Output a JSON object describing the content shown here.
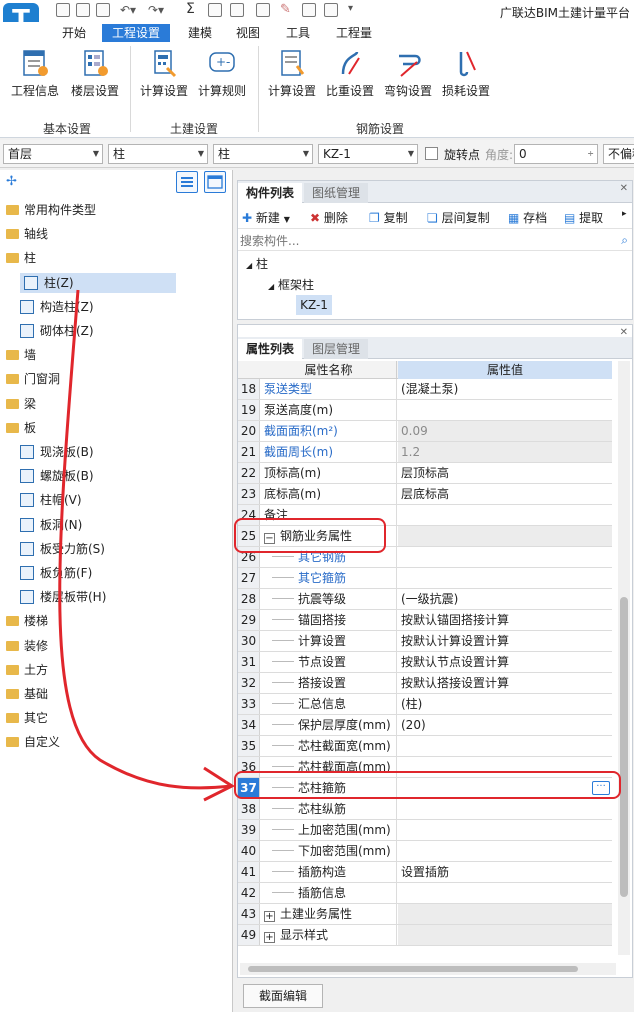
{
  "app": {
    "logo": "T",
    "title": "广联达BIM土建计量平台"
  },
  "ribbon": {
    "tabs": [
      "开始",
      "工程设置",
      "建模",
      "视图",
      "工具",
      "工程量"
    ],
    "active_tab": "工程设置",
    "buttons": [
      "工程信息",
      "楼层设置",
      "计算设置",
      "计算规则",
      "计算设置",
      "比重设置",
      "弯钩设置",
      "损耗设置"
    ],
    "groups": [
      "基本设置",
      "土建设置",
      "钢筋设置"
    ]
  },
  "toolbar": {
    "floor": "首层",
    "type1": "柱",
    "type2": "柱",
    "component": "KZ-1",
    "rotate_label": "旋转点",
    "angle_label": "角度:",
    "angle_value": "0",
    "extra": "不偏移"
  },
  "tree": {
    "items": [
      {
        "label": "常用构件类型",
        "folder": true
      },
      {
        "label": "轴线",
        "folder": true
      },
      {
        "label": "柱",
        "folder": true,
        "expanded": true
      },
      {
        "label": "柱(Z)",
        "child": true,
        "selected": true
      },
      {
        "label": "构造柱(Z)",
        "child": true
      },
      {
        "label": "砌体柱(Z)",
        "child": true
      },
      {
        "label": "墙",
        "folder": true
      },
      {
        "label": "门窗洞",
        "folder": true
      },
      {
        "label": "梁",
        "folder": true
      },
      {
        "label": "板",
        "folder": true,
        "expanded": true
      },
      {
        "label": "现浇板(B)",
        "child": true
      },
      {
        "label": "螺旋板(B)",
        "child": true
      },
      {
        "label": "柱帽(V)",
        "child": true
      },
      {
        "label": "板洞(N)",
        "child": true
      },
      {
        "label": "板受力筋(S)",
        "child": true
      },
      {
        "label": "板负筋(F)",
        "child": true
      },
      {
        "label": "楼层板带(H)",
        "child": true
      },
      {
        "label": "楼梯",
        "folder": true
      },
      {
        "label": "装修",
        "folder": true
      },
      {
        "label": "土方",
        "folder": true
      },
      {
        "label": "基础",
        "folder": true
      },
      {
        "label": "其它",
        "folder": true
      },
      {
        "label": "自定义",
        "folder": true
      }
    ]
  },
  "component_pane": {
    "tabs": [
      "构件列表",
      "图纸管理"
    ],
    "actions": [
      "新建",
      "删除",
      "复制",
      "层间复制",
      "存档",
      "提取"
    ],
    "search_placeholder": "搜索构件...",
    "tree": [
      "柱",
      "框架柱",
      "KZ-1"
    ]
  },
  "property_pane": {
    "tabs": [
      "属性列表",
      "图层管理"
    ],
    "col_name": "属性名称",
    "col_value": "属性值",
    "rows": [
      {
        "n": "18",
        "name": "泵送类型",
        "value": "(混凝土泵)",
        "blue": true
      },
      {
        "n": "19",
        "name": "泵送高度(m)",
        "value": ""
      },
      {
        "n": "20",
        "name": "截面面积(m²)",
        "value": "0.09",
        "blue": true,
        "grey": true
      },
      {
        "n": "21",
        "name": "截面周长(m)",
        "value": "1.2",
        "blue": true,
        "grey": true
      },
      {
        "n": "22",
        "name": "顶标高(m)",
        "value": "层顶标高"
      },
      {
        "n": "23",
        "name": "底标高(m)",
        "value": "层底标高"
      },
      {
        "n": "24",
        "name": "备注",
        "value": ""
      },
      {
        "n": "25",
        "name": "钢筋业务属性",
        "value": "",
        "group": "−"
      },
      {
        "n": "26",
        "name": "其它钢筋",
        "value": "",
        "blue": true,
        "indent": true
      },
      {
        "n": "27",
        "name": "其它箍筋",
        "value": "",
        "blue": true,
        "indent": true
      },
      {
        "n": "28",
        "name": "抗震等级",
        "value": "(一级抗震)",
        "indent": true
      },
      {
        "n": "29",
        "name": "锚固搭接",
        "value": "按默认锚固搭接计算",
        "indent": true
      },
      {
        "n": "30",
        "name": "计算设置",
        "value": "按默认计算设置计算",
        "indent": true
      },
      {
        "n": "31",
        "name": "节点设置",
        "value": "按默认节点设置计算",
        "indent": true
      },
      {
        "n": "32",
        "name": "搭接设置",
        "value": "按默认搭接设置计算",
        "indent": true
      },
      {
        "n": "33",
        "name": "汇总信息",
        "value": "(柱)",
        "indent": true
      },
      {
        "n": "34",
        "name": "保护层厚度(mm)",
        "value": "(20)",
        "indent": true
      },
      {
        "n": "35",
        "name": "芯柱截面宽(mm)",
        "value": "",
        "indent": true
      },
      {
        "n": "36",
        "name": "芯柱截面高(mm)",
        "value": "",
        "indent": true
      },
      {
        "n": "37",
        "name": "芯柱箍筋",
        "value": "",
        "indent": true,
        "active": true
      },
      {
        "n": "38",
        "name": "芯柱纵筋",
        "value": "",
        "indent": true
      },
      {
        "n": "39",
        "name": "上加密范围(mm)",
        "value": "",
        "indent": true
      },
      {
        "n": "40",
        "name": "下加密范围(mm)",
        "value": "",
        "indent": true
      },
      {
        "n": "41",
        "name": "插筋构造",
        "value": "设置插筋",
        "indent": true
      },
      {
        "n": "42",
        "name": "插筋信息",
        "value": "",
        "indent": true
      },
      {
        "n": "43",
        "name": "土建业务属性",
        "value": "",
        "group": "+"
      },
      {
        "n": "49",
        "name": "显示样式",
        "value": "",
        "group": "+"
      }
    ],
    "ellipsis": "···"
  },
  "bottom": {
    "section_edit": "截面编辑"
  },
  "colors": {
    "accent": "#2a7bd8",
    "annotation": "#e0262c"
  }
}
